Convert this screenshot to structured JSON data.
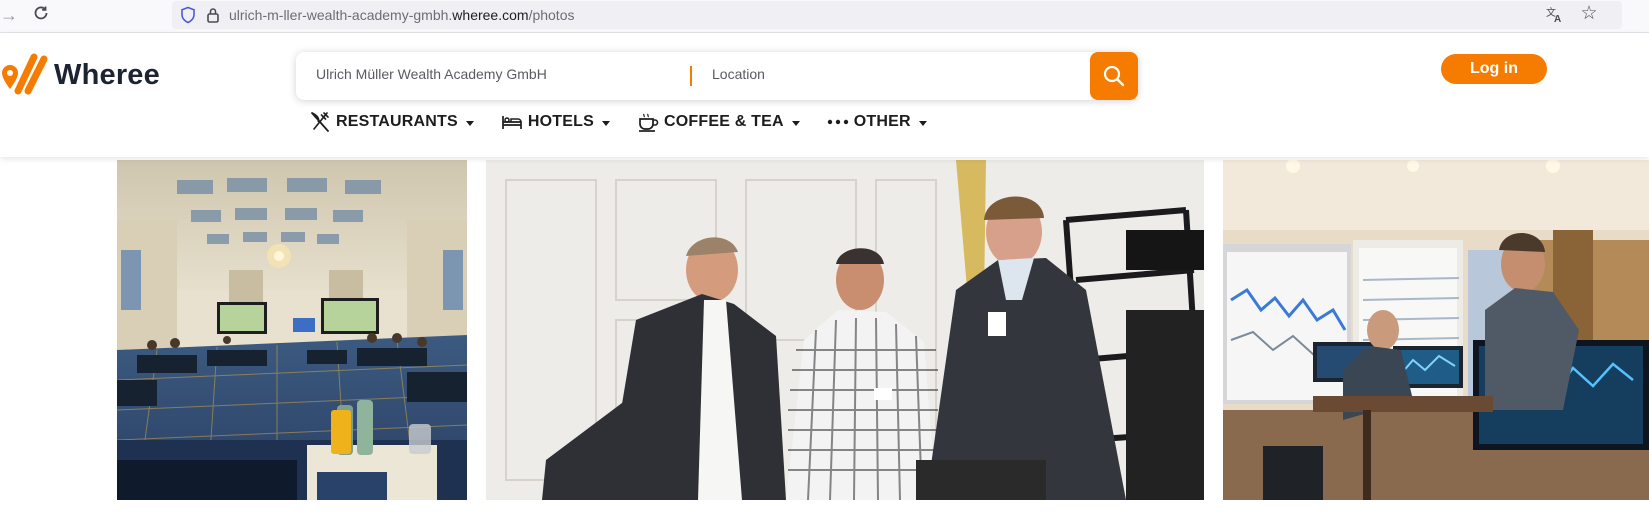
{
  "browser": {
    "url_prefix": "ulrich-m-ller-wealth-academy-gmbh.",
    "url_domain": "wheree.com",
    "url_path": "/photos"
  },
  "site": {
    "brand": "Wheree",
    "brand_color": "#f57c00",
    "search": {
      "query_value": "Ulrich Müller Wealth Academy GmbH",
      "location_placeholder": "Location"
    },
    "login_label": "Log in",
    "categories": [
      {
        "label": "RESTAURANTS",
        "icon": "cutlery-icon"
      },
      {
        "label": "HOTELS",
        "icon": "bed-icon"
      },
      {
        "label": "COFFEE & TEA",
        "icon": "coffee-cup-icon"
      },
      {
        "label": "OTHER",
        "icon": "more-dots-icon"
      }
    ]
  },
  "photos": [
    {
      "subject": "conference-hall-photo"
    },
    {
      "subject": "three-men-talking-photo"
    },
    {
      "subject": "trading-seminar-room-photo"
    }
  ]
}
